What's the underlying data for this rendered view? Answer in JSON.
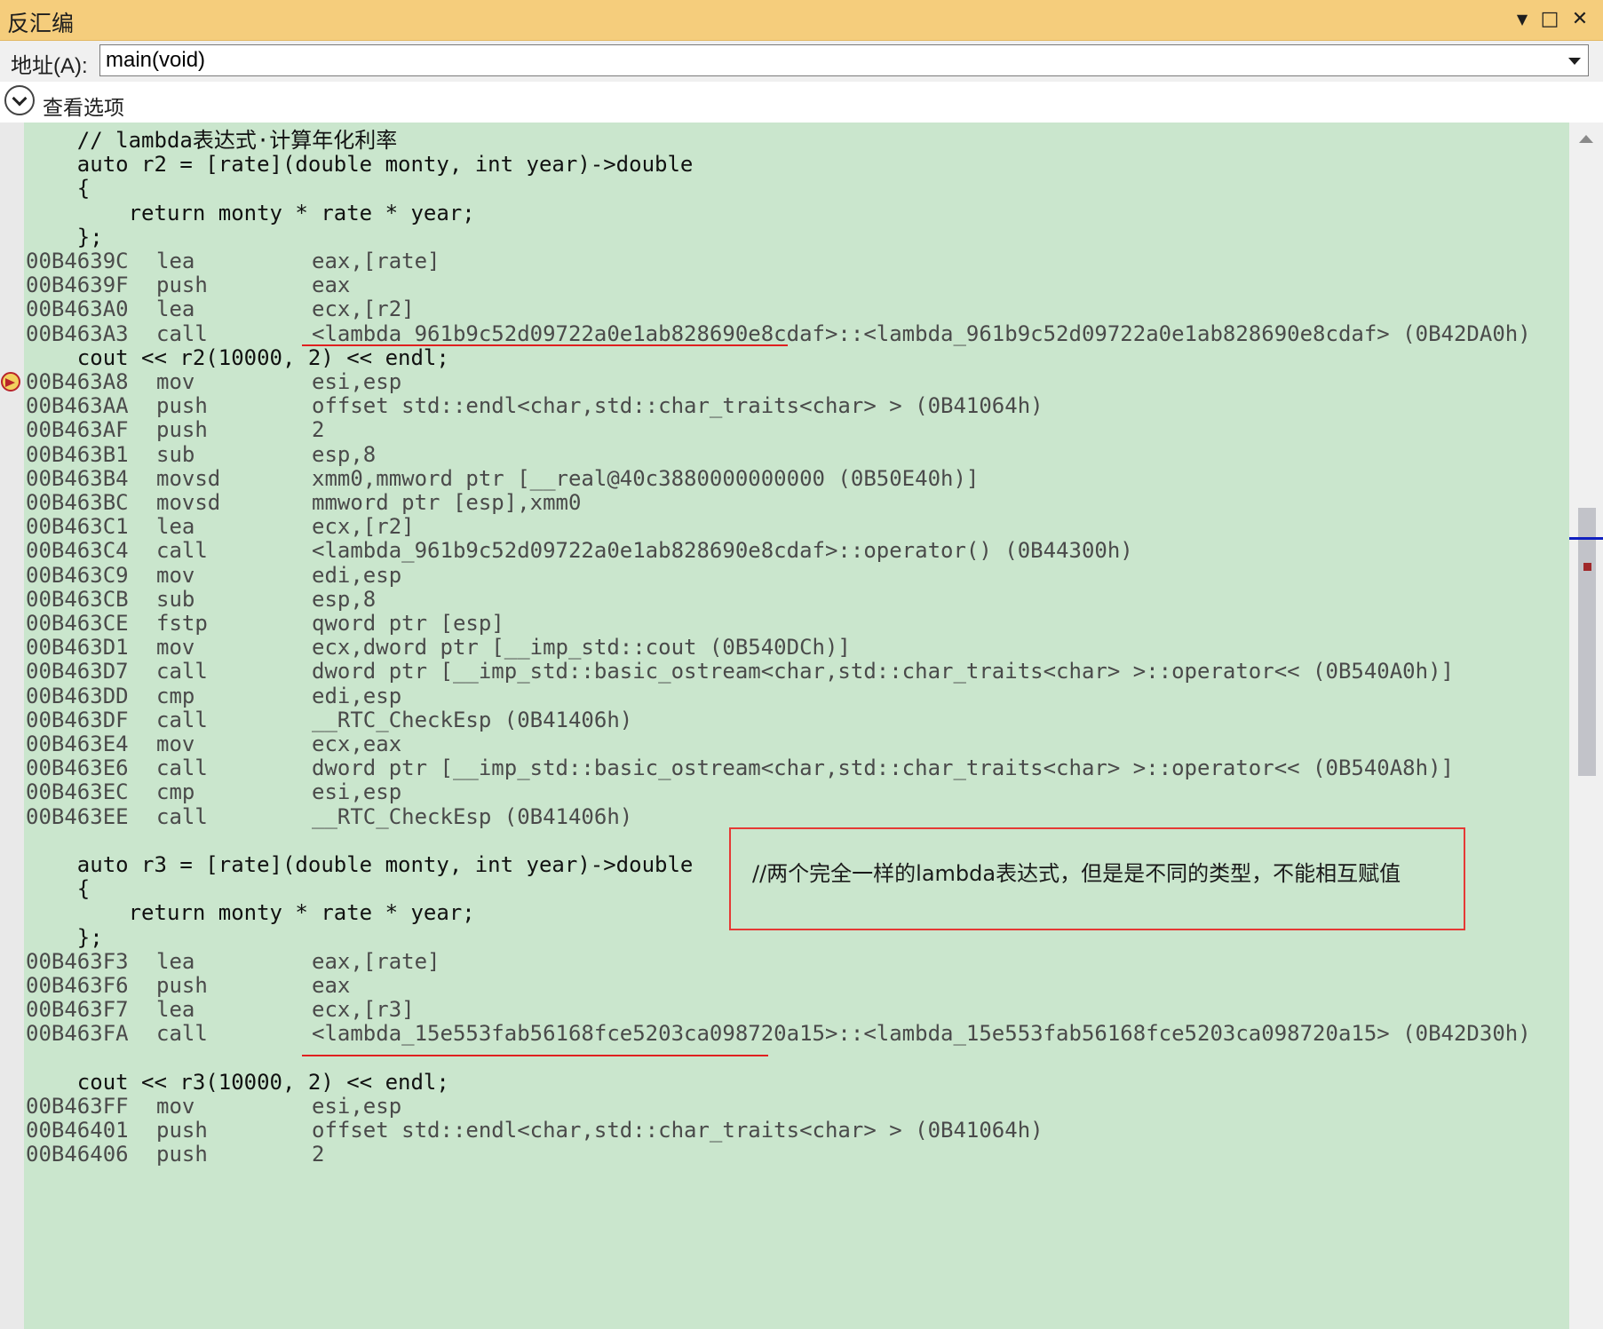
{
  "window": {
    "title": "反汇编",
    "buttons": {
      "dropdown": "▼",
      "maximize": "□",
      "close": "✕"
    }
  },
  "address_bar": {
    "label": "地址(A):",
    "value": "main(void)"
  },
  "view_options": {
    "label": "查看选项"
  },
  "code_lines": [
    {
      "kind": "src",
      "text": "    // lambda表达式·计算年化利率"
    },
    {
      "kind": "src",
      "text": "    auto r2 = [rate](double monty, int year)->double"
    },
    {
      "kind": "src",
      "text": "    {"
    },
    {
      "kind": "src",
      "text": "        return monty * rate * year;"
    },
    {
      "kind": "src",
      "text": "    };"
    },
    {
      "kind": "asm",
      "addr": "00B4639C",
      "mn": "lea",
      "op": "eax,[rate]"
    },
    {
      "kind": "asm",
      "addr": "00B4639F",
      "mn": "push",
      "op": "eax"
    },
    {
      "kind": "asm",
      "addr": "00B463A0",
      "mn": "lea",
      "op": "ecx,[r2]"
    },
    {
      "kind": "asm",
      "addr": "00B463A3",
      "mn": "call",
      "op": "<lambda_961b9c52d09722a0e1ab828690e8cdaf>::<lambda_961b9c52d09722a0e1ab828690e8cdaf> (0B42DA0h)"
    },
    {
      "kind": "src",
      "text": "    cout << r2(10000, 2) << endl;"
    },
    {
      "kind": "asm",
      "addr": "00B463A8",
      "mn": "mov",
      "op": "esi,esp"
    },
    {
      "kind": "asm",
      "addr": "00B463AA",
      "mn": "push",
      "op": "offset std::endl<char,std::char_traits<char> > (0B41064h)"
    },
    {
      "kind": "asm",
      "addr": "00B463AF",
      "mn": "push",
      "op": "2"
    },
    {
      "kind": "asm",
      "addr": "00B463B1",
      "mn": "sub",
      "op": "esp,8"
    },
    {
      "kind": "asm",
      "addr": "00B463B4",
      "mn": "movsd",
      "op": "xmm0,mmword ptr [__real@40c3880000000000 (0B50E40h)]"
    },
    {
      "kind": "asm",
      "addr": "00B463BC",
      "mn": "movsd",
      "op": "mmword ptr [esp],xmm0"
    },
    {
      "kind": "asm",
      "addr": "00B463C1",
      "mn": "lea",
      "op": "ecx,[r2]"
    },
    {
      "kind": "asm",
      "addr": "00B463C4",
      "mn": "call",
      "op": "<lambda_961b9c52d09722a0e1ab828690e8cdaf>::operator() (0B44300h)"
    },
    {
      "kind": "asm",
      "addr": "00B463C9",
      "mn": "mov",
      "op": "edi,esp"
    },
    {
      "kind": "asm",
      "addr": "00B463CB",
      "mn": "sub",
      "op": "esp,8"
    },
    {
      "kind": "asm",
      "addr": "00B463CE",
      "mn": "fstp",
      "op": "qword ptr [esp]"
    },
    {
      "kind": "asm",
      "addr": "00B463D1",
      "mn": "mov",
      "op": "ecx,dword ptr [__imp_std::cout (0B540DCh)]"
    },
    {
      "kind": "asm",
      "addr": "00B463D7",
      "mn": "call",
      "op": "dword ptr [__imp_std::basic_ostream<char,std::char_traits<char> >::operator<< (0B540A0h)]"
    },
    {
      "kind": "asm",
      "addr": "00B463DD",
      "mn": "cmp",
      "op": "edi,esp"
    },
    {
      "kind": "asm",
      "addr": "00B463DF",
      "mn": "call",
      "op": "__RTC_CheckEsp (0B41406h)"
    },
    {
      "kind": "asm",
      "addr": "00B463E4",
      "mn": "mov",
      "op": "ecx,eax"
    },
    {
      "kind": "asm",
      "addr": "00B463E6",
      "mn": "call",
      "op": "dword ptr [__imp_std::basic_ostream<char,std::char_traits<char> >::operator<< (0B540A8h)]"
    },
    {
      "kind": "asm",
      "addr": "00B463EC",
      "mn": "cmp",
      "op": "esi,esp"
    },
    {
      "kind": "asm",
      "addr": "00B463EE",
      "mn": "call",
      "op": "__RTC_CheckEsp (0B41406h)"
    },
    {
      "kind": "src",
      "text": ""
    },
    {
      "kind": "src",
      "text": "    auto r3 = [rate](double monty, int year)->double"
    },
    {
      "kind": "src",
      "text": "    {"
    },
    {
      "kind": "src",
      "text": "        return monty * rate * year;"
    },
    {
      "kind": "src",
      "text": "    };"
    },
    {
      "kind": "asm",
      "addr": "00B463F3",
      "mn": "lea",
      "op": "eax,[rate]"
    },
    {
      "kind": "asm",
      "addr": "00B463F6",
      "mn": "push",
      "op": "eax"
    },
    {
      "kind": "asm",
      "addr": "00B463F7",
      "mn": "lea",
      "op": "ecx,[r3]"
    },
    {
      "kind": "asm",
      "addr": "00B463FA",
      "mn": "call",
      "op": "<lambda_15e553fab56168fce5203ca098720a15>::<lambda_15e553fab56168fce5203ca098720a15> (0B42D30h)"
    },
    {
      "kind": "src",
      "text": ""
    },
    {
      "kind": "src",
      "text": "    cout << r3(10000, 2) << endl;"
    },
    {
      "kind": "asm",
      "addr": "00B463FF",
      "mn": "mov",
      "op": "esi,esp"
    },
    {
      "kind": "asm",
      "addr": "00B46401",
      "mn": "push",
      "op": "offset std::endl<char,std::char_traits<char> > (0B41064h)"
    },
    {
      "kind": "asm",
      "addr": "00B46406",
      "mn": "push",
      "op": "2"
    }
  ],
  "annotation": {
    "text": "//两个完全一样的lambda表达式，但是是不同的类型，不能相互赋值"
  },
  "colors": {
    "title_bg": "#f5cd7c",
    "code_bg": "#cae6cd",
    "annotation_border": "#e53935"
  }
}
